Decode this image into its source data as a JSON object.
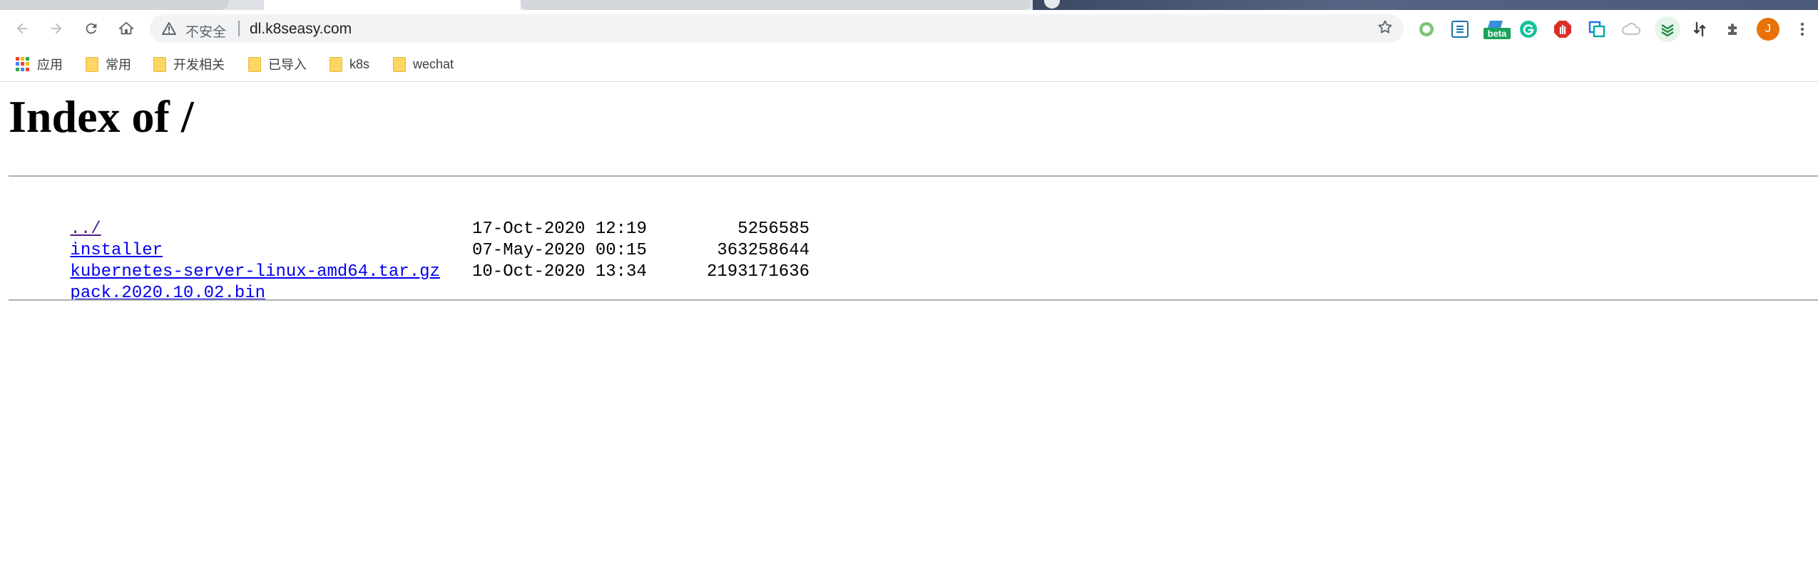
{
  "browser": {
    "address_bar": {
      "security_label": "不安全",
      "url": "dl.k8seasy.com"
    },
    "bookmarks": [
      {
        "label": "应用",
        "icon": "apps-grid-icon"
      },
      {
        "label": "常用",
        "icon": "folder-icon"
      },
      {
        "label": "开发相关",
        "icon": "folder-icon"
      },
      {
        "label": "已导入",
        "icon": "folder-icon"
      },
      {
        "label": "k8s",
        "icon": "folder-icon"
      },
      {
        "label": "wechat",
        "icon": "folder-icon"
      }
    ],
    "extensions": [
      {
        "name": "green-ring-extension-icon"
      },
      {
        "name": "s-box-extension-icon"
      },
      {
        "name": "beta-extension-icon",
        "badge": "beta"
      },
      {
        "name": "grammarly-icon"
      },
      {
        "name": "red-hand-extension-icon"
      },
      {
        "name": "screenshot-extension-icon"
      },
      {
        "name": "cloud-extension-icon"
      },
      {
        "name": "green-layers-extension-icon"
      },
      {
        "name": "transfer-extension-icon"
      },
      {
        "name": "puzzle-extensions-icon"
      }
    ],
    "profile_initial": "J",
    "colors": {
      "link": "#0000ee",
      "visited_link": "#551a8b",
      "profile": "#e8710a"
    }
  },
  "page": {
    "title": "Index of /",
    "entries": [
      {
        "name": "../",
        "date": "",
        "size": "",
        "visited": true
      },
      {
        "name": "installer",
        "date": "17-Oct-2020 12:19",
        "size": "5256585",
        "visited": false
      },
      {
        "name": "kubernetes-server-linux-amd64.tar.gz",
        "date": "07-May-2020 00:15",
        "size": "363258644",
        "visited": false
      },
      {
        "name": "pack.2020.10.02.bin",
        "date": "10-Oct-2020 13:34",
        "size": "2193171636",
        "visited": false
      }
    ]
  }
}
